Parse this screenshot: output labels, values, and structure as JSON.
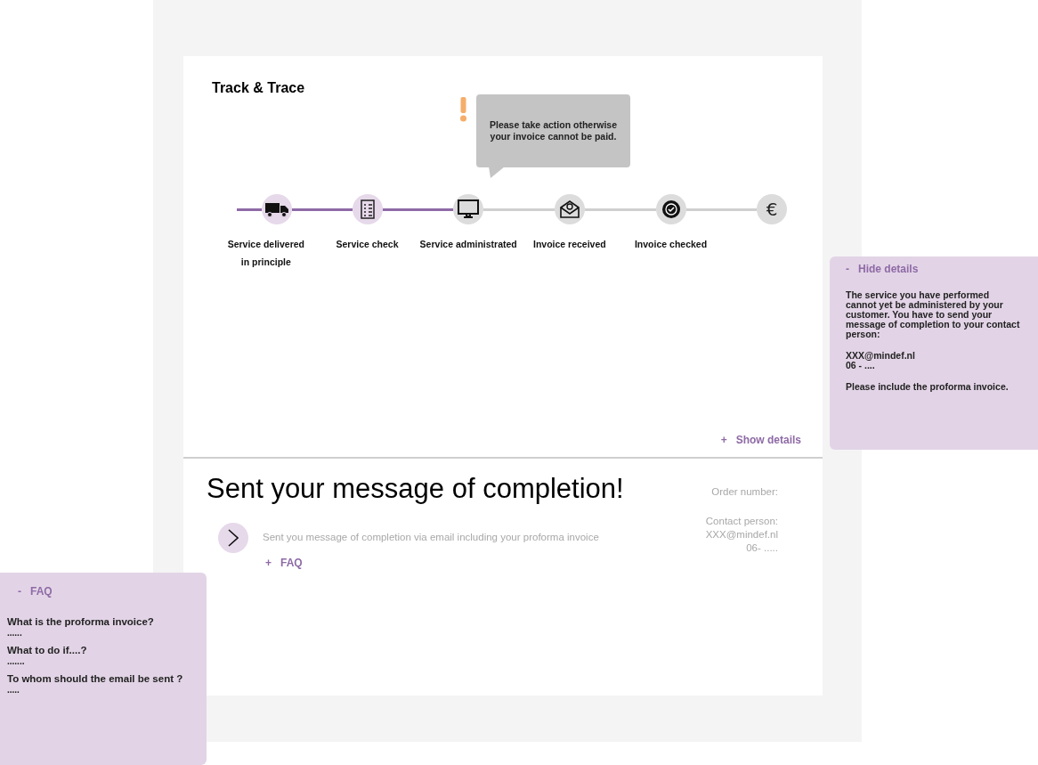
{
  "title": "Track & Trace",
  "alert": {
    "message": "Please take action otherwise your invoice cannot be paid."
  },
  "steps": [
    {
      "label_lines": [
        "Service delivered",
        "in principle"
      ],
      "kind": "truck",
      "completed": true,
      "reached": true
    },
    {
      "label_lines": [
        "Service check"
      ],
      "kind": "checklist",
      "completed": true,
      "reached": true
    },
    {
      "label_lines": [
        "Service administrated"
      ],
      "kind": "monitor",
      "completed": false,
      "reached": true
    },
    {
      "label_lines": [
        "Invoice received"
      ],
      "kind": "envelope",
      "completed": false,
      "reached": false
    },
    {
      "label_lines": [
        "Invoice checked"
      ],
      "kind": "badge",
      "completed": false,
      "reached": false
    },
    {
      "symbol": "€",
      "kind": "symbol",
      "completed": false,
      "reached": false
    }
  ],
  "show_details": "+   Show details",
  "details_panel": {
    "toggle": "-   Hide details",
    "blocks": [
      [
        "The service you have performed cannot yet be administered by your customer. You have to send your message of completion to your contact person:"
      ],
      [
        "XXX@mindef.nl",
        "06 - ...."
      ],
      [
        "Please include the proforma invoice."
      ]
    ]
  },
  "completion": {
    "heading": "Sent your message of completion!",
    "action_text": "Sent you message of completion via email including your proforma invoice",
    "faq_link": "+   FAQ",
    "order_label": "Order number:",
    "contact_label": "Contact person:",
    "contact_email": "XXX@mindef.nl",
    "contact_phone": "06- ....."
  },
  "faq_panel": {
    "toggle": "-   FAQ",
    "items": [
      {
        "question": "What is the proforma invoice?",
        "answer": "......"
      },
      {
        "question": "What to do if....?",
        "answer": "......."
      },
      {
        "question": "To whom should the email be sent ?",
        "answer": "....."
      }
    ]
  }
}
